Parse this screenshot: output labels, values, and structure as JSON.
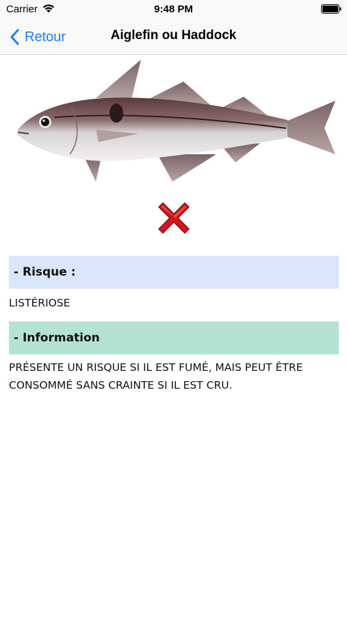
{
  "status_bar": {
    "carrier": "Carrier",
    "time": "9:48 PM"
  },
  "nav": {
    "back_label": "Retour",
    "title": "Aiglefin ou Haddock"
  },
  "verdict_icon": "red-cross-icon",
  "sections": {
    "risk": {
      "header": "- Risque :",
      "text": "LISTÉRIOSE"
    },
    "info": {
      "header": "- Information",
      "text": "PRÉSENTE UN RISQUE SI IL EST FUMÉ, MAIS PEUT ÊTRE CONSOMMÉ SANS CRAINTE SI IL EST CRU."
    }
  },
  "colors": {
    "accent": "#1f7ef5",
    "risk_header_bg": "#d9e6fc",
    "info_header_bg": "#b4e3d3",
    "cross": "#d11620"
  }
}
